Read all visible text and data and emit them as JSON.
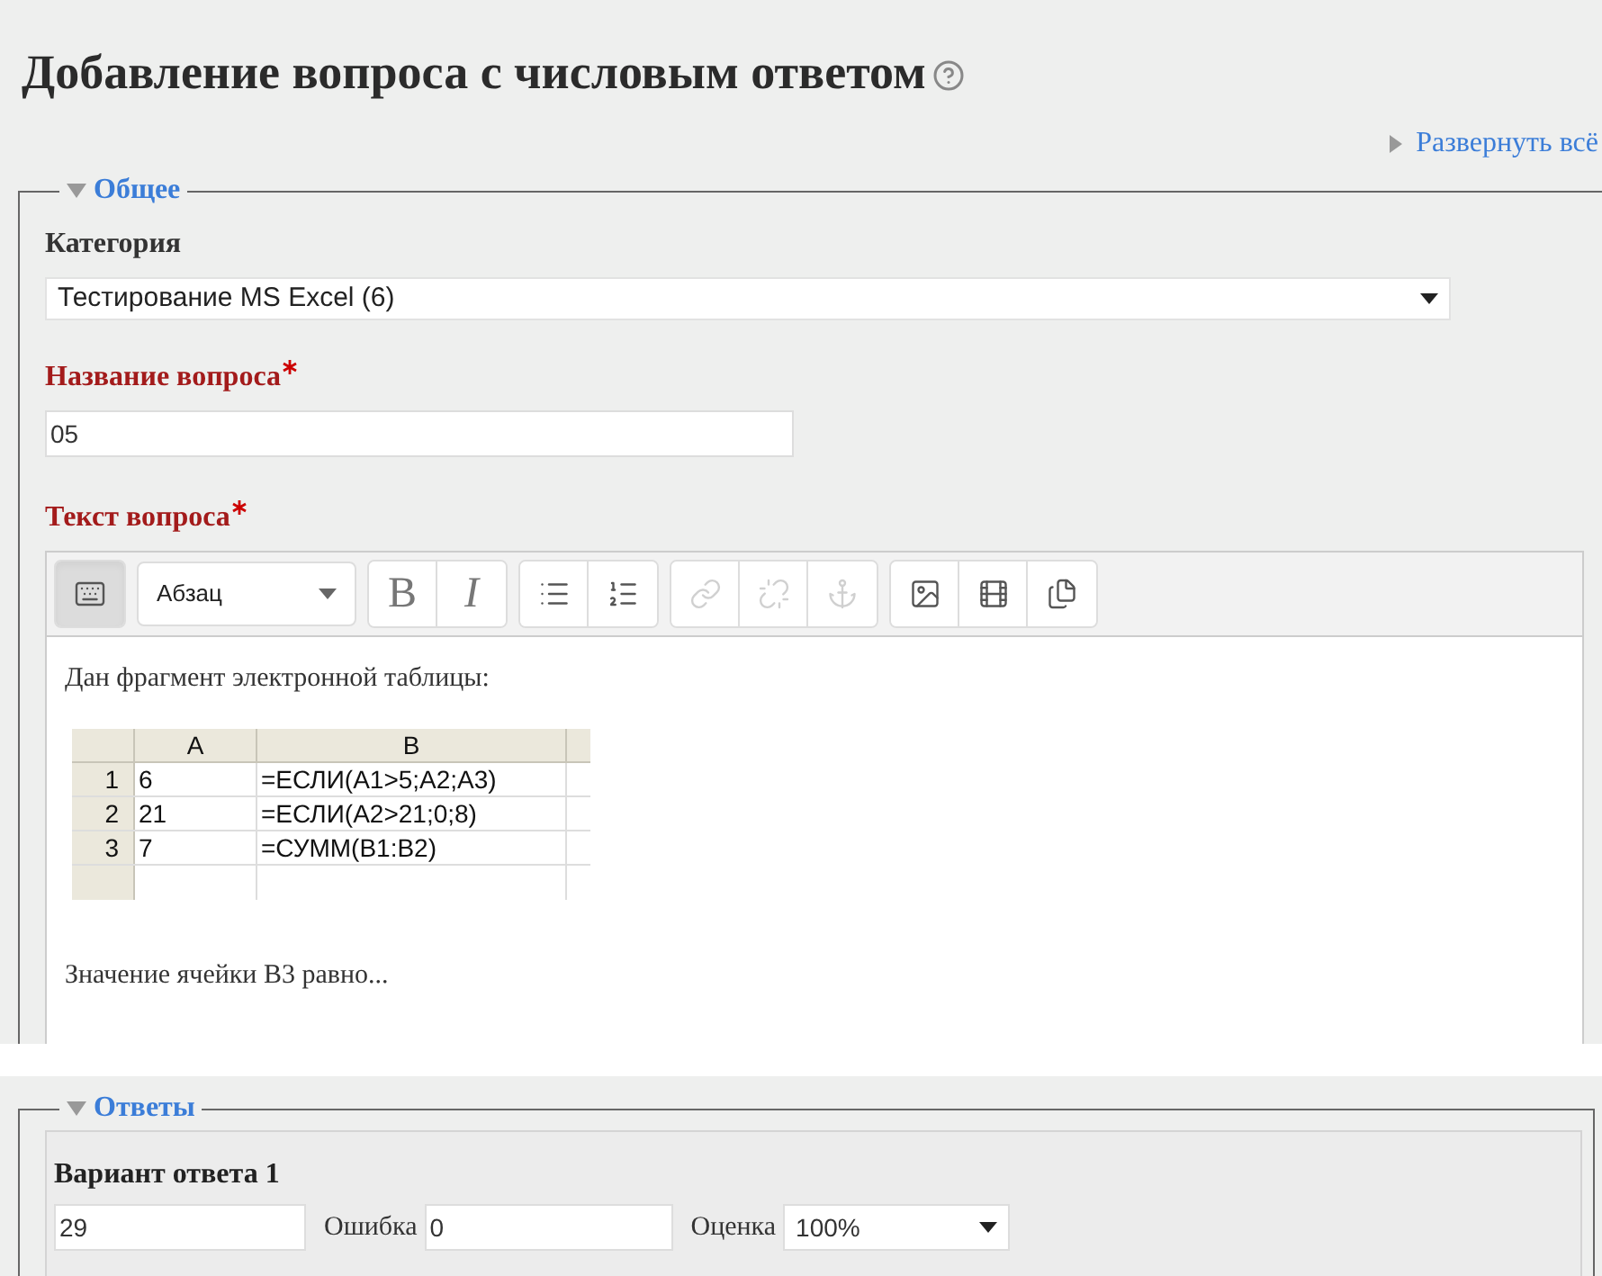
{
  "page_title": "Добавление вопроса с числовым ответом",
  "expand_all": "Развернуть всё",
  "general": {
    "legend": "Общее",
    "expanded": true,
    "category": {
      "label": "Категория",
      "value": "Тестирование MS Excel (6)"
    },
    "name": {
      "label": "Название вопроса",
      "required": true,
      "value": "05"
    },
    "text": {
      "label": "Текст вопроса",
      "required": true,
      "toolbar": [
        [
          {
            "kind": "toggle",
            "pressed": true,
            "disabled": false
          }
        ],
        [
          {
            "kind": "format",
            "label": "Абзац"
          }
        ],
        [
          {
            "kind": "bold",
            "label": "B",
            "pressed": false,
            "disabled": false
          },
          {
            "kind": "italic",
            "label": "I",
            "pressed": false,
            "disabled": false
          }
        ],
        [
          {
            "kind": "bullets",
            "pressed": false,
            "disabled": false
          },
          {
            "kind": "numbers",
            "pressed": false,
            "disabled": false
          }
        ],
        [
          {
            "kind": "link",
            "pressed": false,
            "disabled": true
          },
          {
            "kind": "unlink",
            "pressed": false,
            "disabled": true
          },
          {
            "kind": "anchor",
            "pressed": false,
            "disabled": true
          }
        ],
        [
          {
            "kind": "image",
            "pressed": false,
            "disabled": false
          },
          {
            "kind": "media",
            "pressed": false,
            "disabled": false
          },
          {
            "kind": "files",
            "pressed": false,
            "disabled": false
          }
        ]
      ],
      "intro": "Дан фрагмент электронной таблицы:",
      "sheet": {
        "columns": [
          "A",
          "B"
        ],
        "rows": [
          {
            "header": "1",
            "cells": [
              "6",
              "=ЕСЛИ(A1>5;A2;A3)"
            ]
          },
          {
            "header": "2",
            "cells": [
              "21",
              "=ЕСЛИ(A2>21;0;8)"
            ]
          },
          {
            "header": "3",
            "cells": [
              "7",
              "=СУММ(B1:B2)"
            ]
          }
        ]
      },
      "question": "Значение ячейки B3 равно..."
    }
  },
  "answers": {
    "legend": "Ответы",
    "expanded": true,
    "items": [
      {
        "label": "Вариант ответа 1",
        "answer": "29",
        "error_label": "Ошибка",
        "error": "0",
        "grade_label": "Оценка",
        "grade": "100%"
      }
    ]
  }
}
